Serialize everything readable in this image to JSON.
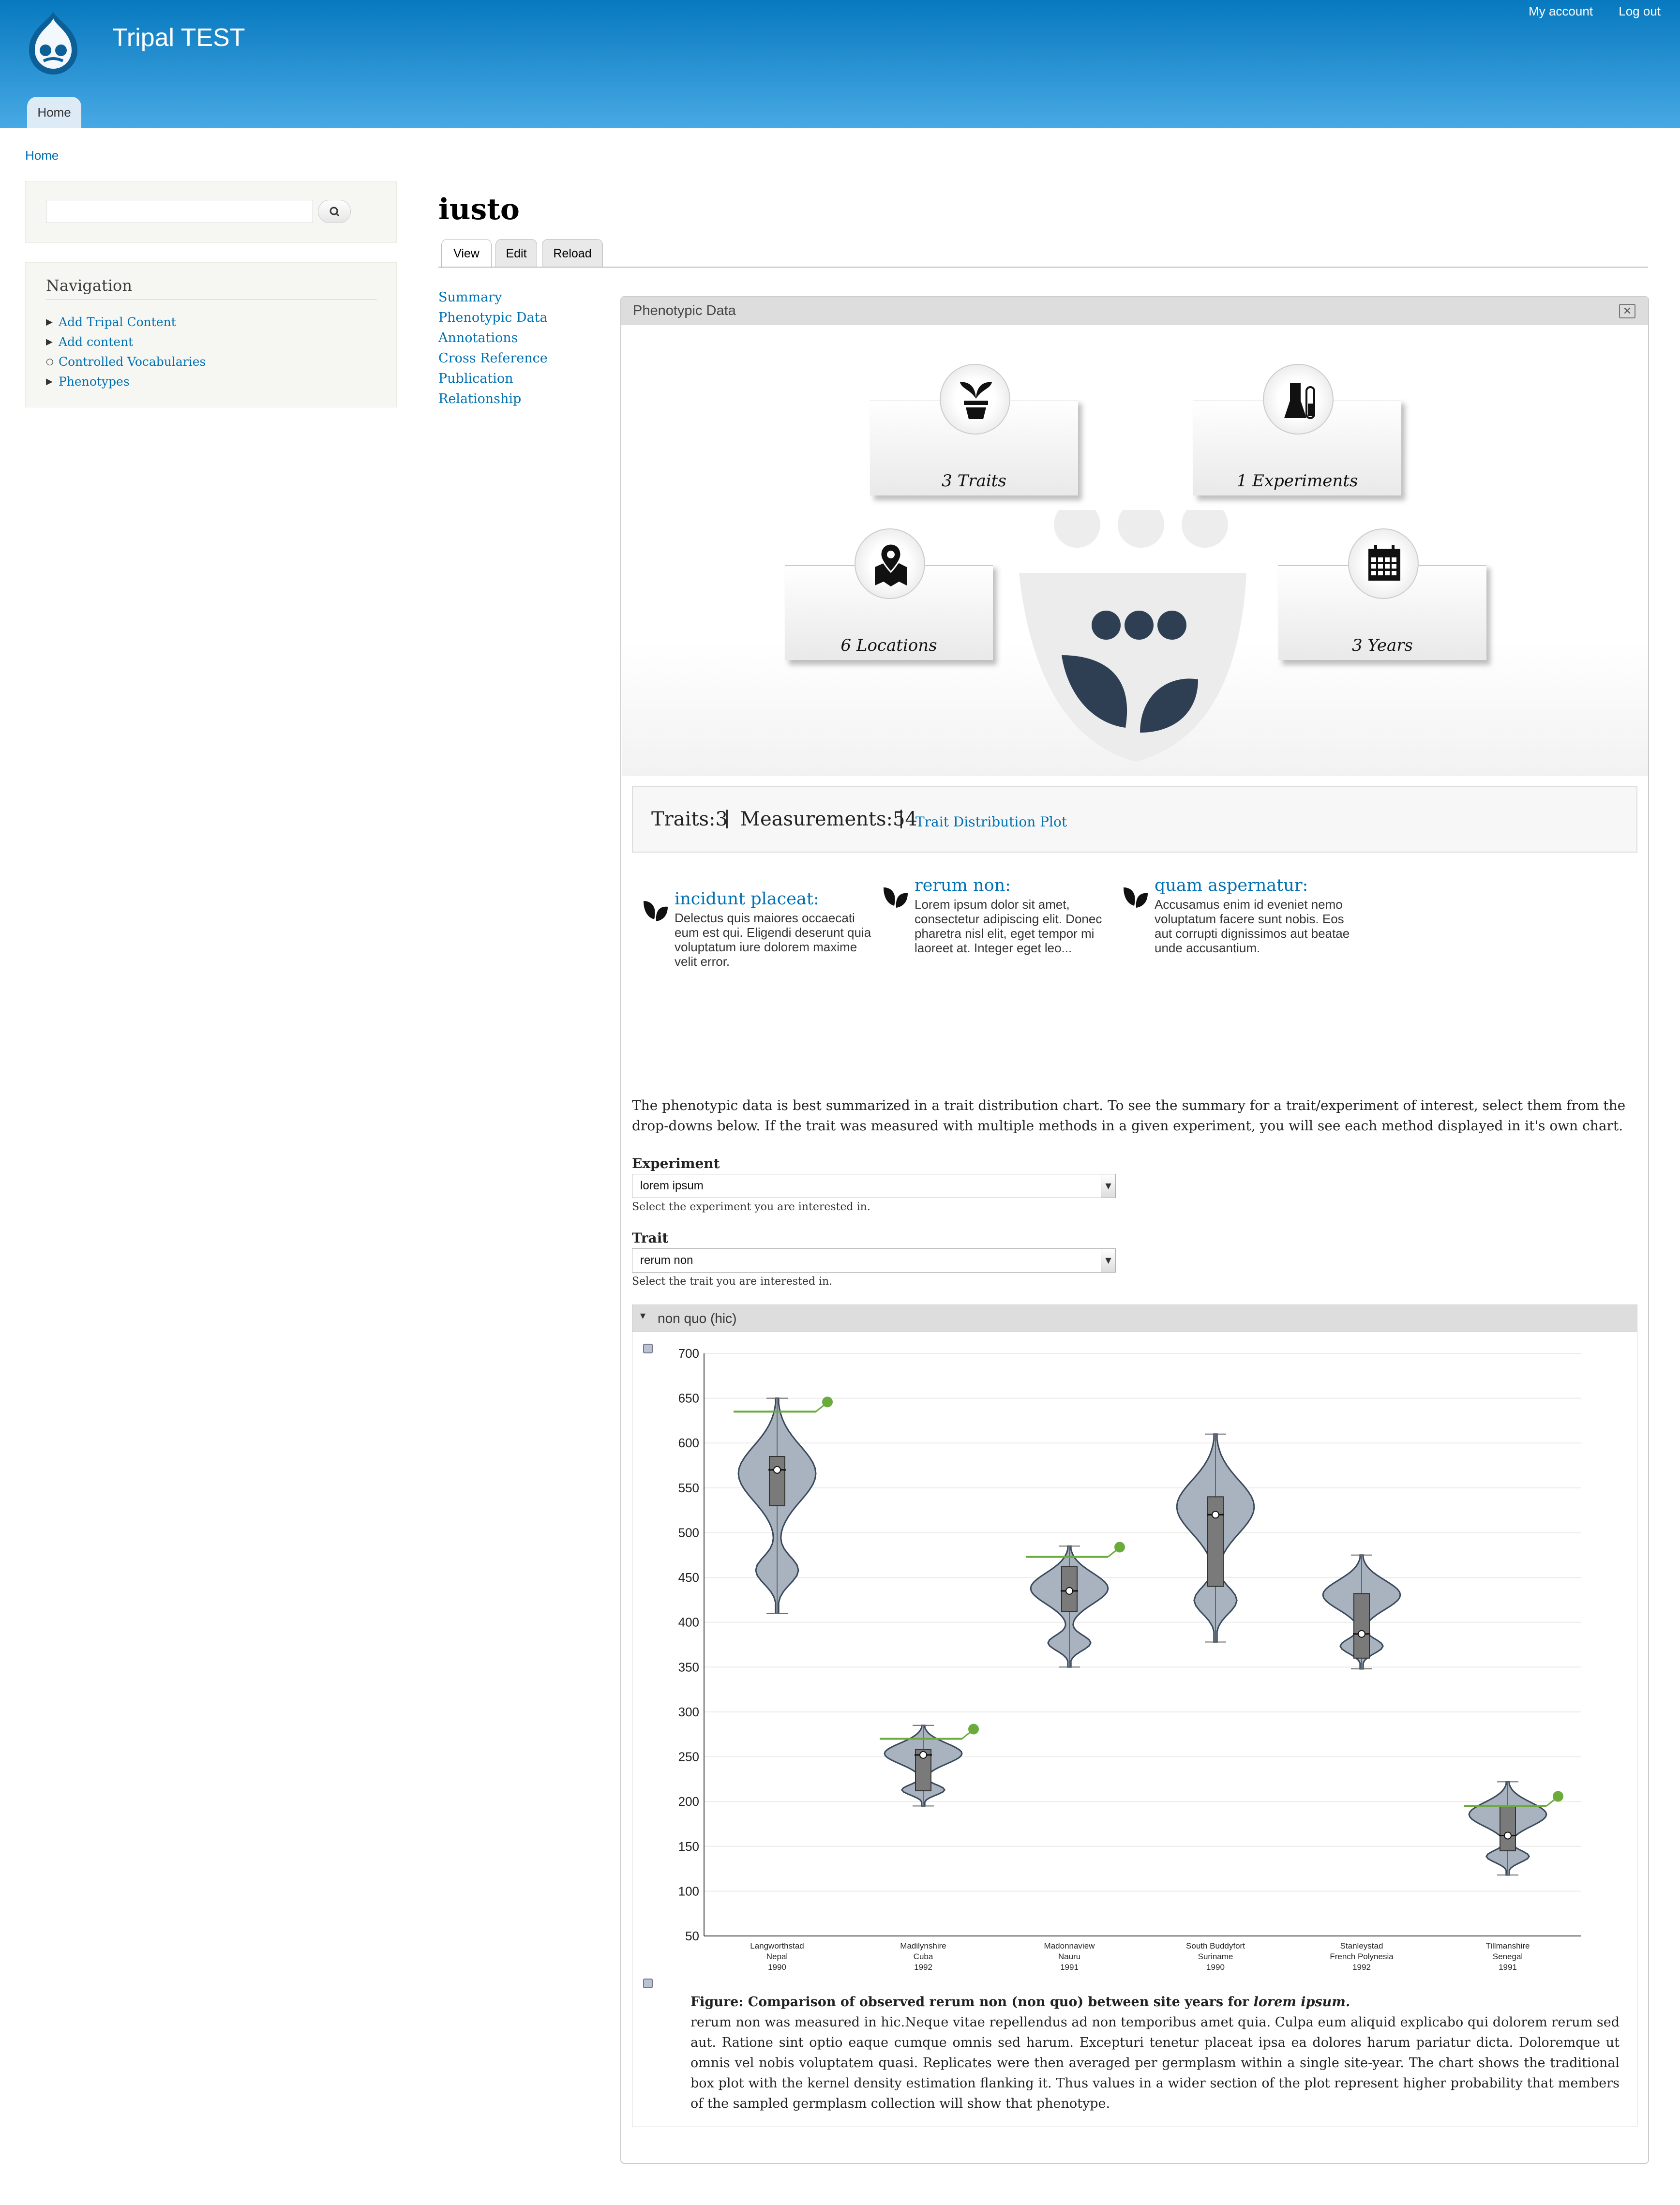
{
  "site": {
    "name": "Tripal TEST",
    "account_link": "My account",
    "logout_link": "Log out",
    "home_tab": "Home"
  },
  "breadcrumb": "Home",
  "search": {
    "placeholder": ""
  },
  "navigation": {
    "title": "Navigation",
    "items": [
      {
        "label": "Add Tripal Content",
        "marker": "triangle"
      },
      {
        "label": "Add content",
        "marker": "triangle"
      },
      {
        "label": "Controlled Vocabularies",
        "marker": "circle"
      },
      {
        "label": "Phenotypes",
        "marker": "triangle"
      }
    ]
  },
  "page": {
    "title": "iusto",
    "tabs": [
      "View",
      "Edit",
      "Reload"
    ],
    "active_tab": "View",
    "pane_links": [
      "Summary",
      "Phenotypic Data",
      "Annotations",
      "Cross Reference",
      "Publication",
      "Relationship"
    ]
  },
  "panel": {
    "title": "Phenotypic Data",
    "close_icon": "close-icon",
    "summary_cards": [
      {
        "label": "3 Traits",
        "icon": "plant-pot-icon"
      },
      {
        "label": "1 Experiments",
        "icon": "lab-flask-icon"
      },
      {
        "label": "6 Locations",
        "icon": "map-pin-icon"
      },
      {
        "label": "3 Years",
        "icon": "calendar-icon"
      }
    ],
    "stats": {
      "traits_label": "Traits:3",
      "measurements_label": "Measurements:54",
      "plot_link": "Trait Distribution Plot"
    },
    "traits": [
      {
        "name": "incidunt placeat:",
        "description": "Delectus quis maiores occaecati eum est qui. Eligendi deserunt quia voluptatum iure dolorem maxime velit error."
      },
      {
        "name": "rerum non:",
        "description": "Lorem ipsum dolor sit amet, consectetur adipiscing elit. Donec pharetra nisl elit, eget tempor mi laoreet at. Integer eget leo..."
      },
      {
        "name": "quam aspernatur:",
        "description": "Accusamus enim id eveniet nemo voluptatum facere sunt nobis. Eos aut corrupti dignissimos aut beatae unde accusantium."
      }
    ],
    "intro": "The phenotypic data is best summarized in a trait distribution chart. To see the summary for a trait/experiment of interest, select them from the drop-downs below. If the trait was measured with multiple methods in a given experiment, you will see each method displayed in it's own chart.",
    "experiment": {
      "label": "Experiment",
      "value": "lorem ipsum",
      "help": "Select the experiment you are interested in."
    },
    "trait": {
      "label": "Trait",
      "value": "rerum non",
      "help": "Select the trait you are interested in."
    },
    "chart_section": {
      "label": "non quo (hic)"
    },
    "caption": {
      "title_prefix": "Figure: Comparison of observed rerum non (non quo) between site years for ",
      "title_emph": "lorem ipsum.",
      "body": "rerum non was measured in hic.Neque vitae repellendus ad non temporibus amet quia. Culpa eum aliquid explicabo qui dolorem rerum sed aut. Ratione sint optio eaque cumque omnis sed harum. Excepturi tenetur placeat ipsa ea dolores harum pariatur dicta. Doloremque ut omnis vel nobis voluptatem quasi. Replicates were then averaged per germplasm within a single site-year. The chart shows the traditional box plot with the kernel density estimation flanking it. Thus values in a wider section of the plot represent higher probability that members of the sampled germplasm collection will show that phenotype."
    }
  },
  "chart_data": {
    "type": "violin",
    "ylim": [
      50,
      700
    ],
    "yticks": [
      50,
      100,
      150,
      200,
      250,
      300,
      350,
      400,
      450,
      500,
      550,
      600,
      650,
      700
    ],
    "grid": true,
    "violin_color": "#a9b2bf",
    "highlight_color": "#6aab3c",
    "groups": [
      {
        "site": "Langworthstad",
        "country": "Nepal",
        "year": "1990",
        "min": 410,
        "q1": 530,
        "median": 570,
        "q3": 585,
        "max": 650,
        "mean": 570,
        "highlight": 635
      },
      {
        "site": "Madilynshire",
        "country": "Cuba",
        "year": "1992",
        "min": 195,
        "q1": 212,
        "median": 252,
        "q3": 258,
        "max": 285,
        "mean": 252,
        "highlight": 270
      },
      {
        "site": "Madonnaview",
        "country": "Nauru",
        "year": "1991",
        "min": 350,
        "q1": 412,
        "median": 435,
        "q3": 462,
        "max": 485,
        "mean": 435,
        "highlight": 473
      },
      {
        "site": "South Buddyfort",
        "country": "Suriname",
        "year": "1990",
        "min": 378,
        "q1": 440,
        "median": 520,
        "q3": 540,
        "max": 610,
        "mean": 520,
        "highlight": null
      },
      {
        "site": "Stanleystad",
        "country": "French Polynesia",
        "year": "1992",
        "min": 348,
        "q1": 360,
        "median": 387,
        "q3": 432,
        "max": 475,
        "mean": 387,
        "highlight": null
      },
      {
        "site": "Tillmanshire",
        "country": "Senegal",
        "year": "1991",
        "min": 118,
        "q1": 145,
        "median": 162,
        "q3": 195,
        "max": 222,
        "mean": 162,
        "highlight": 195
      }
    ]
  }
}
